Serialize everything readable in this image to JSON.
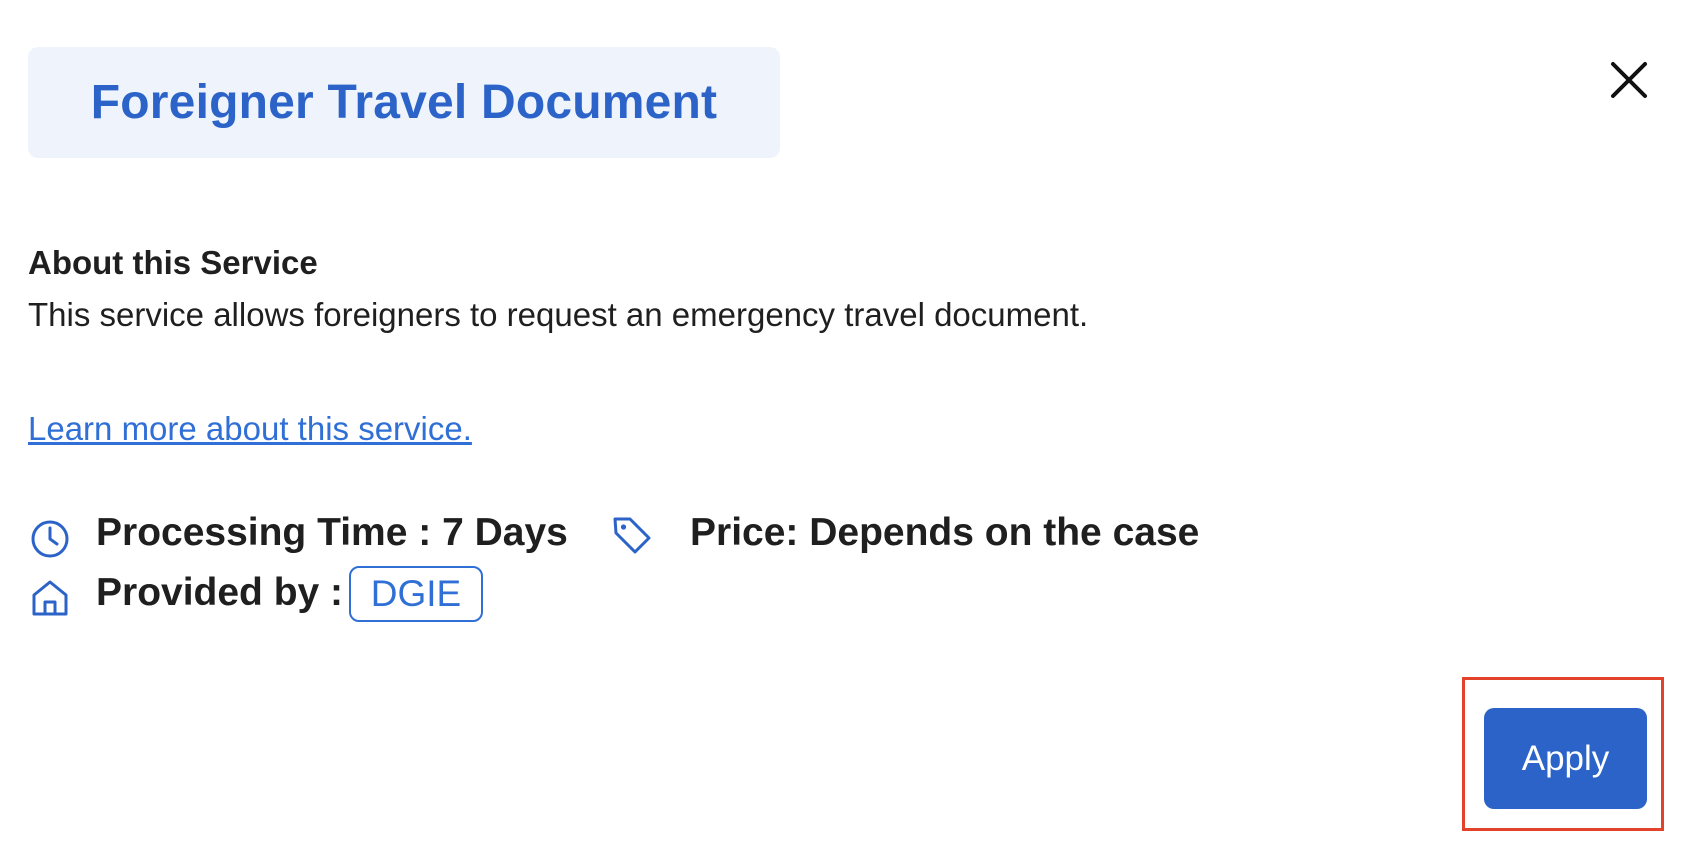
{
  "header": {
    "title": "Foreigner Travel Document"
  },
  "about": {
    "heading": "About this Service",
    "description": "This service allows foreigners to request an emergency travel document.",
    "learn_more_link": "Learn more about this service."
  },
  "details": {
    "processing_time": "Processing Time : 7 Days",
    "price": "Price: Depends on the case",
    "provided_by_label": "Provided by :",
    "provider": "DGIE"
  },
  "actions": {
    "apply_label": "Apply"
  },
  "icons": {
    "close": "close-icon",
    "clock": "clock-icon",
    "tag": "tag-icon",
    "home": "home-icon"
  },
  "colors": {
    "accent": "#2b63c9",
    "title_bg": "#eef3fc",
    "link": "#2f6fd6",
    "highlight": "#e2432a"
  }
}
